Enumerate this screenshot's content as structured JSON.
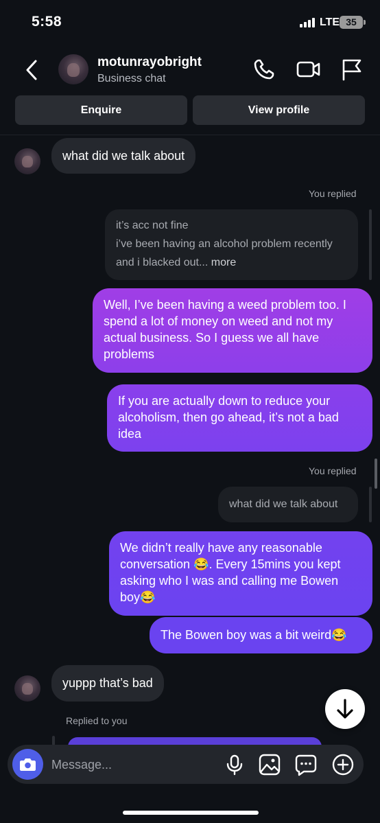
{
  "status": {
    "time": "5:58",
    "network": "LTE",
    "battery": "35"
  },
  "header": {
    "username": "motunrayobright",
    "subtitle": "Business chat"
  },
  "actions": {
    "enquire": "Enquire",
    "view_profile": "View profile"
  },
  "messages": {
    "m1": "what did we talk about",
    "you_replied_1": "You replied",
    "quote1_line1": "it’s acc not fine",
    "quote1_line2": "i’ve been having an alcohol problem recently",
    "quote1_line3": "and i blacked out...",
    "quote1_more": "more",
    "m2": "Well, I’ve been having a weed problem too. I spend a lot of money on weed and not my actual business. So I guess we all have problems",
    "m3": "If you are actually down to reduce your alcoholism, then go ahead, it’s not a bad idea",
    "you_replied_2": "You replied",
    "quote2": "what did we talk about",
    "m4": "We didn’t really have any reasonable conversation 😂. Every 15mins you kept asking who I was and calling me Bowen boy😂",
    "m5": "The Bowen boy was a bit weird😂",
    "m6": "yuppp that’s bad",
    "replied_to_you": "Replied to you"
  },
  "composer": {
    "placeholder": "Message..."
  },
  "colors": {
    "accent": "#4f5ee8",
    "bubble_out_top": "#a03ee6",
    "bubble_out_bottom": "#6a42f0",
    "bubble_in": "#25282e"
  },
  "icons": [
    "back-icon",
    "phone-icon",
    "video-icon",
    "flag-icon",
    "camera-icon",
    "mic-icon",
    "image-icon",
    "sticker-icon",
    "plus-icon",
    "arrow-down-icon"
  ]
}
